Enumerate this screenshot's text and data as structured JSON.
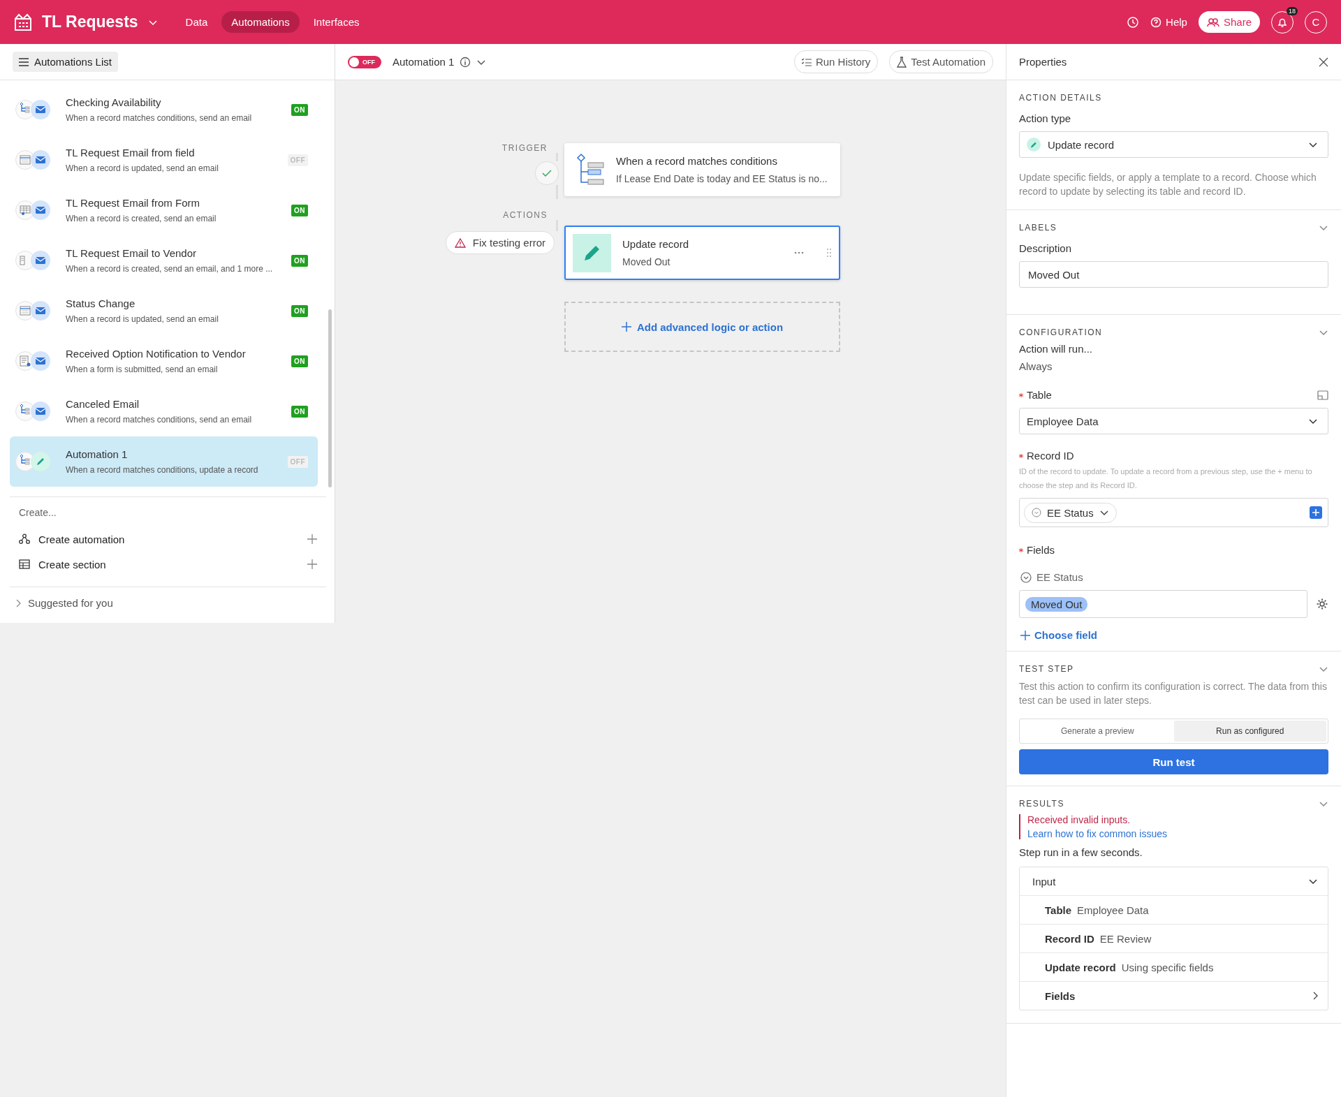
{
  "app": {
    "title": "TL Requests",
    "nav": [
      {
        "label": "Data",
        "selected": false
      },
      {
        "label": "Automations",
        "selected": true
      },
      {
        "label": "Interfaces",
        "selected": false
      }
    ],
    "help": "Help",
    "share": "Share",
    "notification_count": "18",
    "avatar": "C"
  },
  "sidebar": {
    "list_button": "Automations List",
    "automations": [
      {
        "name": "Checking Availability",
        "description": "When a record matches conditions, send an email",
        "icons": {
          "trigger": {
            "kind": "conditions"
          },
          "action": {
            "kind": "email"
          }
        },
        "on": true,
        "badge": "ON",
        "selected": false
      },
      {
        "name": "TL Request Email from field",
        "description": "When a record is updated, send an email",
        "icons": {
          "trigger": {
            "kind": "updated"
          },
          "action": {
            "kind": "email"
          }
        },
        "on": false,
        "badge": "OFF",
        "selected": false
      },
      {
        "name": "TL Request Email from Form",
        "description": "When a record is created, send an email",
        "icons": {
          "trigger": {
            "kind": "created"
          },
          "action": {
            "kind": "email"
          }
        },
        "on": true,
        "badge": "ON",
        "selected": false
      },
      {
        "name": "TL Request Email to Vendor",
        "description": "When a record is created, send an email, and 1 more ...",
        "icons": {
          "trigger": {
            "kind": "multi"
          },
          "action": {
            "kind": "email"
          }
        },
        "on": true,
        "badge": "ON",
        "selected": false
      },
      {
        "name": "Status Change",
        "description": "When a record is updated, send an email",
        "icons": {
          "trigger": {
            "kind": "updated"
          },
          "action": {
            "kind": "email"
          }
        },
        "on": true,
        "badge": "ON",
        "selected": false
      },
      {
        "name": "Received Option Notification to Vendor",
        "description": "When a form is submitted, send an email",
        "icons": {
          "trigger": {
            "kind": "form"
          },
          "action": {
            "kind": "email"
          }
        },
        "on": true,
        "badge": "ON",
        "selected": false
      },
      {
        "name": "Canceled Email",
        "description": "When a record matches conditions, send an email",
        "icons": {
          "trigger": {
            "kind": "conditions"
          },
          "action": {
            "kind": "email"
          }
        },
        "on": true,
        "badge": "ON",
        "selected": false
      },
      {
        "name": "Automation 1",
        "description": "When a record matches conditions, update a record",
        "icons": {
          "trigger": {
            "kind": "conditions"
          },
          "action": {
            "kind": "update"
          }
        },
        "on": false,
        "badge": "OFF",
        "selected": true
      }
    ],
    "create_heading": "Create...",
    "create_items": [
      {
        "label": "Create automation",
        "kind": "automation"
      },
      {
        "label": "Create section",
        "kind": "section"
      }
    ],
    "suggested": "Suggested for you"
  },
  "toolbar": {
    "on": false,
    "toggle_label": "OFF",
    "name": "Automation 1",
    "run_history": "Run History",
    "test_automation": "Test Automation"
  },
  "canvas": {
    "trigger_label": "TRIGGER",
    "trigger": {
      "title": "When a record matches conditions",
      "description": "If Lease End Date is today and EE Status is no..."
    },
    "actions_label": "ACTIONS",
    "fix_button": "Fix testing error",
    "action": {
      "title": "Update record",
      "description": "Moved Out",
      "selected": true
    },
    "add_button": "Add advanced logic or action"
  },
  "properties": {
    "title": "Properties",
    "action_details": {
      "heading": "ACTION DETAILS",
      "label": "Action type",
      "value": "Update record",
      "help": "Update specific fields, or apply a template to a record. Choose which record to update by selecting its table and record ID."
    },
    "labels": {
      "heading": "LABELS",
      "label": "Description",
      "value": "Moved Out"
    },
    "configuration": {
      "heading": "CONFIGURATION",
      "run_label": "Action will run...",
      "run_value": "Always",
      "table_label": "Table",
      "table_value": "Employee Data",
      "record_label": "Record ID",
      "record_help": "ID of the record to update. To update a record from a previous step, use the + menu to choose the step and its Record ID.",
      "record_token": "EE Status",
      "fields_label": "Fields",
      "field_name": "EE Status",
      "field_value": "Moved Out",
      "choose_field": "Choose field"
    },
    "test_step": {
      "heading": "TEST STEP",
      "help": "Test this action to confirm its configuration is correct. The data from this test can be used in later steps.",
      "modes": [
        {
          "label": "Generate a preview",
          "selected": false
        },
        {
          "label": "Run as configured",
          "selected": true
        }
      ],
      "run_button": "Run test"
    },
    "results": {
      "heading": "RESULTS",
      "error": "Received invalid inputs.",
      "link": "Learn how to fix common issues",
      "summary": "Step run in a few seconds.",
      "input_label": "Input",
      "rows": [
        {
          "key": "Table",
          "value": "Employee Data",
          "kind": "pair"
        },
        {
          "key": "Record ID",
          "value": "EE Review",
          "kind": "pair"
        },
        {
          "key": "Update record",
          "value": "Using specific fields",
          "kind": "pair"
        },
        {
          "key": "Fields",
          "kind": "expand"
        }
      ]
    }
  }
}
